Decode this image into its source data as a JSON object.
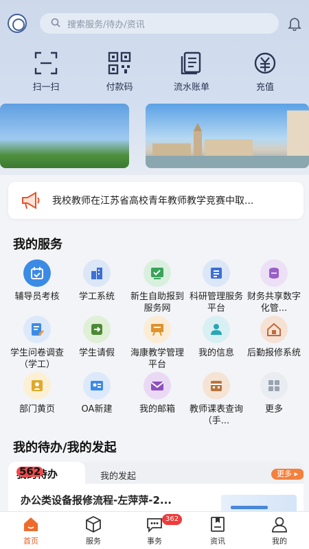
{
  "header": {
    "search_placeholder": "搜索服务/待办/资讯"
  },
  "quick_actions": [
    {
      "label": "扫一扫",
      "icon": "scan-icon"
    },
    {
      "label": "付款码",
      "icon": "qrcode-icon"
    },
    {
      "label": "流水账单",
      "icon": "bill-icon"
    },
    {
      "label": "充值",
      "icon": "recharge-icon"
    }
  ],
  "notice": {
    "text": "我校教师在江苏省高校青年教师教学竞赛中取..."
  },
  "services": {
    "title": "我的服务",
    "items": [
      {
        "label": "辅导员考核",
        "icon": "calendar-check-icon",
        "color": "#3b8be6",
        "bg": "#3b8be6"
      },
      {
        "label": "学工系统",
        "icon": "building-icon",
        "color": "#3d6fd4",
        "bg": "#dbe6f7"
      },
      {
        "label": "新生自助报到服务网",
        "icon": "checkin-icon",
        "color": "#3aa35a",
        "bg": "#daf0df"
      },
      {
        "label": "科研管理服务平台",
        "icon": "research-icon",
        "color": "#3d6fd4",
        "bg": "#dbe6f7"
      },
      {
        "label": "财务共享数字化管...",
        "icon": "coins-icon",
        "color": "#9a5fc8",
        "bg": "#ece0f6"
      },
      {
        "label": "学生问卷调查（学工）",
        "icon": "survey-icon",
        "color": "#3b8be6",
        "bg": "#dce9fa"
      },
      {
        "label": "学生请假",
        "icon": "leave-icon",
        "color": "#4c8a36",
        "bg": "#dff0d6"
      },
      {
        "label": "海康教学管理平台",
        "icon": "teaching-board-icon",
        "color": "#e0922c",
        "bg": "#fbecd6"
      },
      {
        "label": "我的信息",
        "icon": "profile-icon",
        "color": "#2aa5b8",
        "bg": "#d8f0f3"
      },
      {
        "label": "后勤报修系统",
        "icon": "repair-house-icon",
        "color": "#c06a3a",
        "bg": "#f6e2d5"
      },
      {
        "label": "部门黄页",
        "icon": "yellow-pages-icon",
        "color": "#e0a82c",
        "bg": "#fbf0d4"
      },
      {
        "label": "OA新建",
        "icon": "oa-new-icon",
        "color": "#3b8be6",
        "bg": "#dce9fa"
      },
      {
        "label": "我的邮箱",
        "icon": "mail-icon",
        "color": "#8e4fbf",
        "bg": "#ead9f5"
      },
      {
        "label": "教师课表查询（手...",
        "icon": "timetable-icon",
        "color": "#b8743c",
        "bg": "#f5e3d4"
      },
      {
        "label": "更多",
        "icon": "more-grid-icon",
        "color": "#9aa3b0",
        "bg": "#e9ecf1"
      }
    ]
  },
  "todo": {
    "title": "我的待办/我的发起",
    "tab_active": "我的待办",
    "tab_active_badge": "562",
    "tab_other": "我的发起",
    "more_label": "更多 ▸",
    "first_item": "办公类设备报修流程-左萍萍-2..."
  },
  "tabbar": [
    {
      "label": "首页",
      "icon": "home-icon",
      "active": true
    },
    {
      "label": "服务",
      "icon": "service-cube-icon",
      "active": false
    },
    {
      "label": "事务",
      "icon": "chat-icon",
      "active": false,
      "badge": "362"
    },
    {
      "label": "资讯",
      "icon": "news-bookmark-icon",
      "active": false
    },
    {
      "label": "我的",
      "icon": "user-icon",
      "active": false
    }
  ],
  "colors": {
    "accent": "#e55b1e",
    "badge": "#ef3b3b",
    "top_background": "#cdd9ea"
  }
}
